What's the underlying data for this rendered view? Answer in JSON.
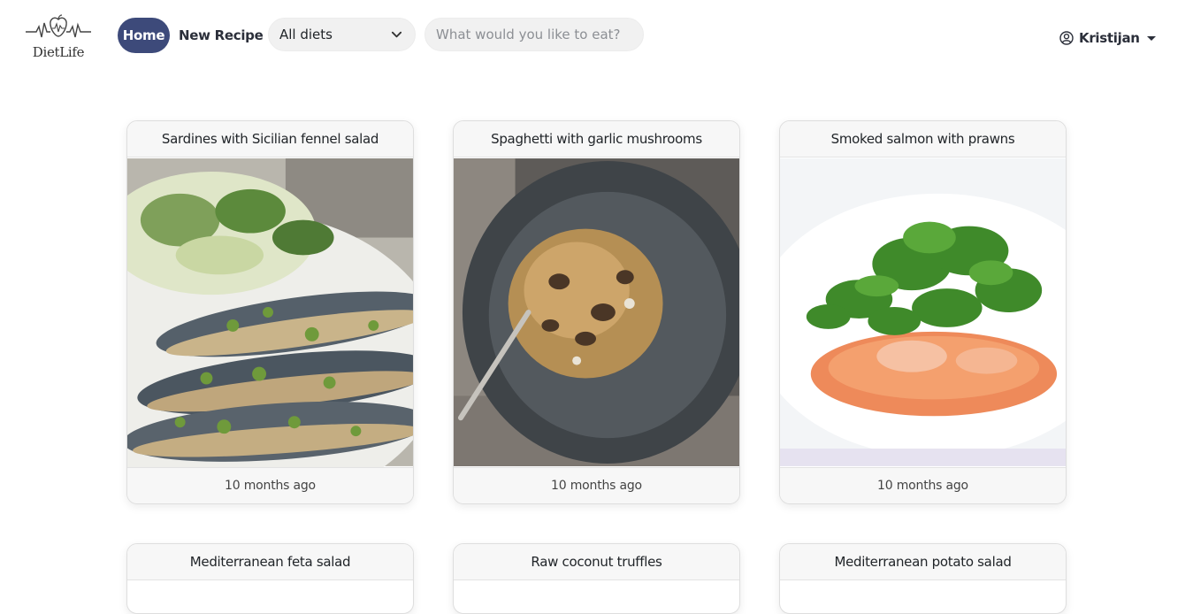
{
  "brand": {
    "name": "DietLife",
    "icon": "heartbeat-apple-icon"
  },
  "nav": {
    "home_label": "Home",
    "new_recipe_label": "New Recipe"
  },
  "filters": {
    "diet_selected": "All diets",
    "search_placeholder": "What would you like to eat?"
  },
  "user": {
    "name": "Kristijan",
    "icon": "user-circle-icon"
  },
  "colors": {
    "accent": "#3d4a7a",
    "card_header_bg": "#f7f7f7"
  },
  "recipes": [
    {
      "title": "Sardines with Sicilian fennel salad",
      "time": "10 months ago",
      "image": "grilled-sardines-photo"
    },
    {
      "title": "Spaghetti with garlic mushrooms",
      "time": "10 months ago",
      "image": "mushroom-spaghetti-photo"
    },
    {
      "title": "Smoked salmon with prawns",
      "time": "10 months ago",
      "image": "salmon-prawns-photo"
    },
    {
      "title": "Mediterranean feta salad",
      "time": "",
      "image": ""
    },
    {
      "title": "Raw coconut truffles",
      "time": "",
      "image": ""
    },
    {
      "title": "Mediterranean potato salad",
      "time": "",
      "image": ""
    }
  ]
}
